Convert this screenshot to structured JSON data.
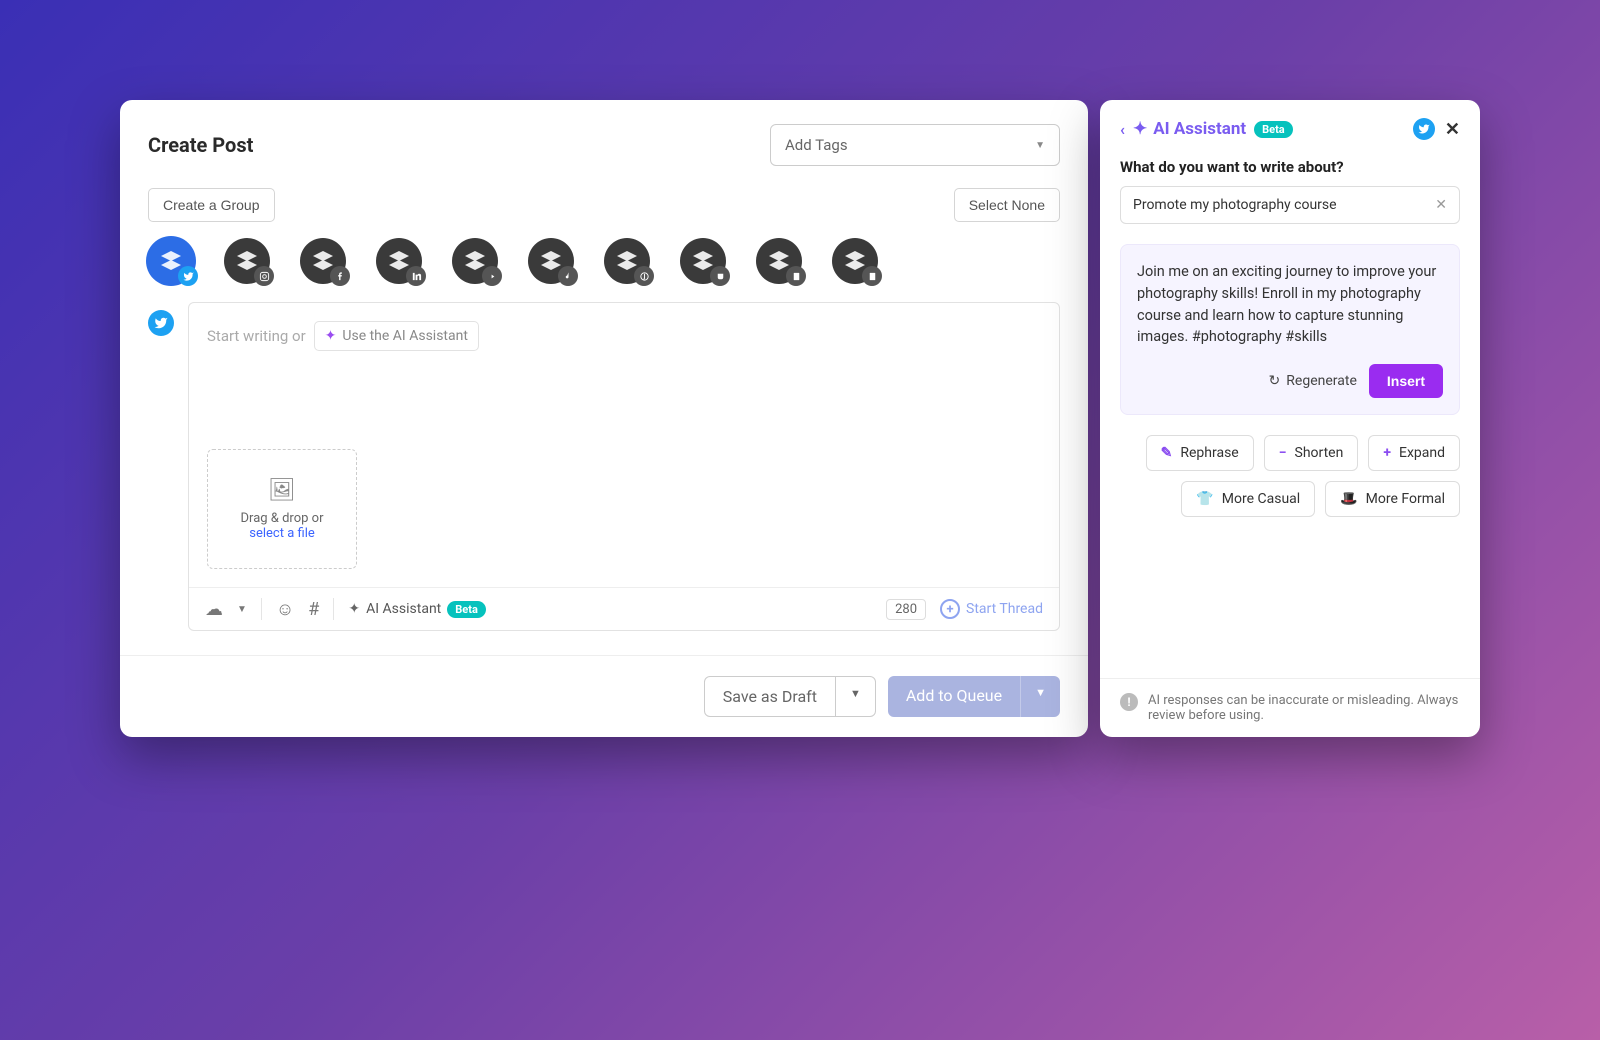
{
  "left": {
    "title": "Create Post",
    "tags_placeholder": "Add Tags",
    "create_group": "Create a Group",
    "select_none": "Select None",
    "composer": {
      "placeholder": "Start writing or",
      "ai_chip": "Use the AI Assistant",
      "drag_drop": "Drag & drop or",
      "select_file": "select a file",
      "ai_assistant": "AI Assistant",
      "beta": "Beta",
      "char_count": "280",
      "start_thread": "Start Thread"
    },
    "footer": {
      "save_draft": "Save as Draft",
      "add_queue": "Add to Queue"
    }
  },
  "channels": [
    {
      "network": "twitter",
      "selected": true
    },
    {
      "network": "instagram",
      "selected": false
    },
    {
      "network": "facebook",
      "selected": false
    },
    {
      "network": "linkedin",
      "selected": false
    },
    {
      "network": "youtube",
      "selected": false
    },
    {
      "network": "tiktok",
      "selected": false
    },
    {
      "network": "pinterest",
      "selected": false
    },
    {
      "network": "mastodon",
      "selected": false
    },
    {
      "network": "startpage1",
      "selected": false
    },
    {
      "network": "startpage2",
      "selected": false
    }
  ],
  "right": {
    "title": "AI Assistant",
    "beta": "Beta",
    "question": "What do you want to write about?",
    "input_value": "Promote my photography course",
    "result_text": "Join me on an exciting journey to improve your photography skills! Enroll in my photography course and learn how to capture stunning images. #photography #skills",
    "regenerate": "Regenerate",
    "insert": "Insert",
    "tones": {
      "rephrase": "Rephrase",
      "shorten": "Shorten",
      "expand": "Expand",
      "casual": "More Casual",
      "formal": "More Formal"
    },
    "disclaimer": "AI responses can be inaccurate or misleading. Always review before using."
  }
}
